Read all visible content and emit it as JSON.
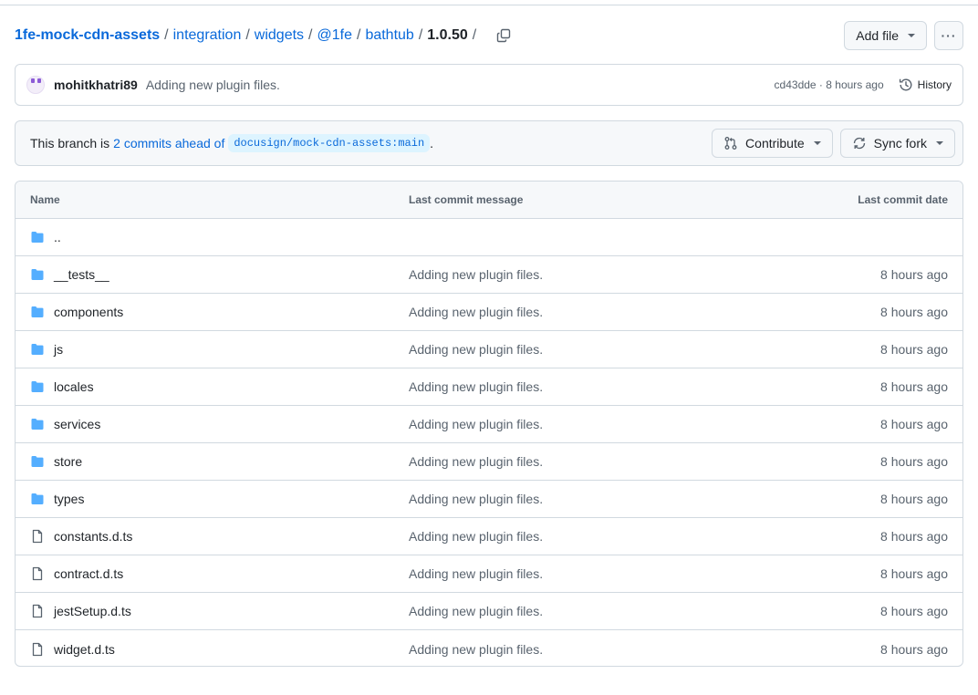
{
  "breadcrumb": {
    "repo": "1fe-mock-cdn-assets",
    "parts": [
      "integration",
      "widgets",
      "@1fe",
      "bathtub"
    ],
    "current": "1.0.50",
    "trailing_sep": "/"
  },
  "actions": {
    "add_file": "Add file",
    "more": "···"
  },
  "commit": {
    "author": "mohitkhatri89",
    "message": "Adding new plugin files.",
    "sha": "cd43dde",
    "time": "8 hours ago",
    "history": "History"
  },
  "branch": {
    "prefix": "This branch is",
    "link": "2 commits ahead of",
    "ref": "docusign/mock-cdn-assets:main",
    "suffix": ".",
    "contribute": "Contribute",
    "sync": "Sync fork"
  },
  "table": {
    "headers": {
      "name": "Name",
      "message": "Last commit message",
      "date": "Last commit date"
    },
    "rows": [
      {
        "name": "..",
        "type": "folder",
        "message": "",
        "date": ""
      },
      {
        "name": "__tests__",
        "type": "folder",
        "message": "Adding new plugin files.",
        "date": "8 hours ago"
      },
      {
        "name": "components",
        "type": "folder",
        "message": "Adding new plugin files.",
        "date": "8 hours ago"
      },
      {
        "name": "js",
        "type": "folder",
        "message": "Adding new plugin files.",
        "date": "8 hours ago"
      },
      {
        "name": "locales",
        "type": "folder",
        "message": "Adding new plugin files.",
        "date": "8 hours ago"
      },
      {
        "name": "services",
        "type": "folder",
        "message": "Adding new plugin files.",
        "date": "8 hours ago"
      },
      {
        "name": "store",
        "type": "folder",
        "message": "Adding new plugin files.",
        "date": "8 hours ago"
      },
      {
        "name": "types",
        "type": "folder",
        "message": "Adding new plugin files.",
        "date": "8 hours ago"
      },
      {
        "name": "constants.d.ts",
        "type": "file",
        "message": "Adding new plugin files.",
        "date": "8 hours ago"
      },
      {
        "name": "contract.d.ts",
        "type": "file",
        "message": "Adding new plugin files.",
        "date": "8 hours ago"
      },
      {
        "name": "jestSetup.d.ts",
        "type": "file",
        "message": "Adding new plugin files.",
        "date": "8 hours ago"
      },
      {
        "name": "widget.d.ts",
        "type": "file",
        "message": "Adding new plugin files.",
        "date": "8 hours ago"
      }
    ]
  },
  "colors": {
    "link": "#0969da",
    "folder": "#54aeff",
    "muted": "#59636e",
    "border": "#d1d9e0"
  }
}
